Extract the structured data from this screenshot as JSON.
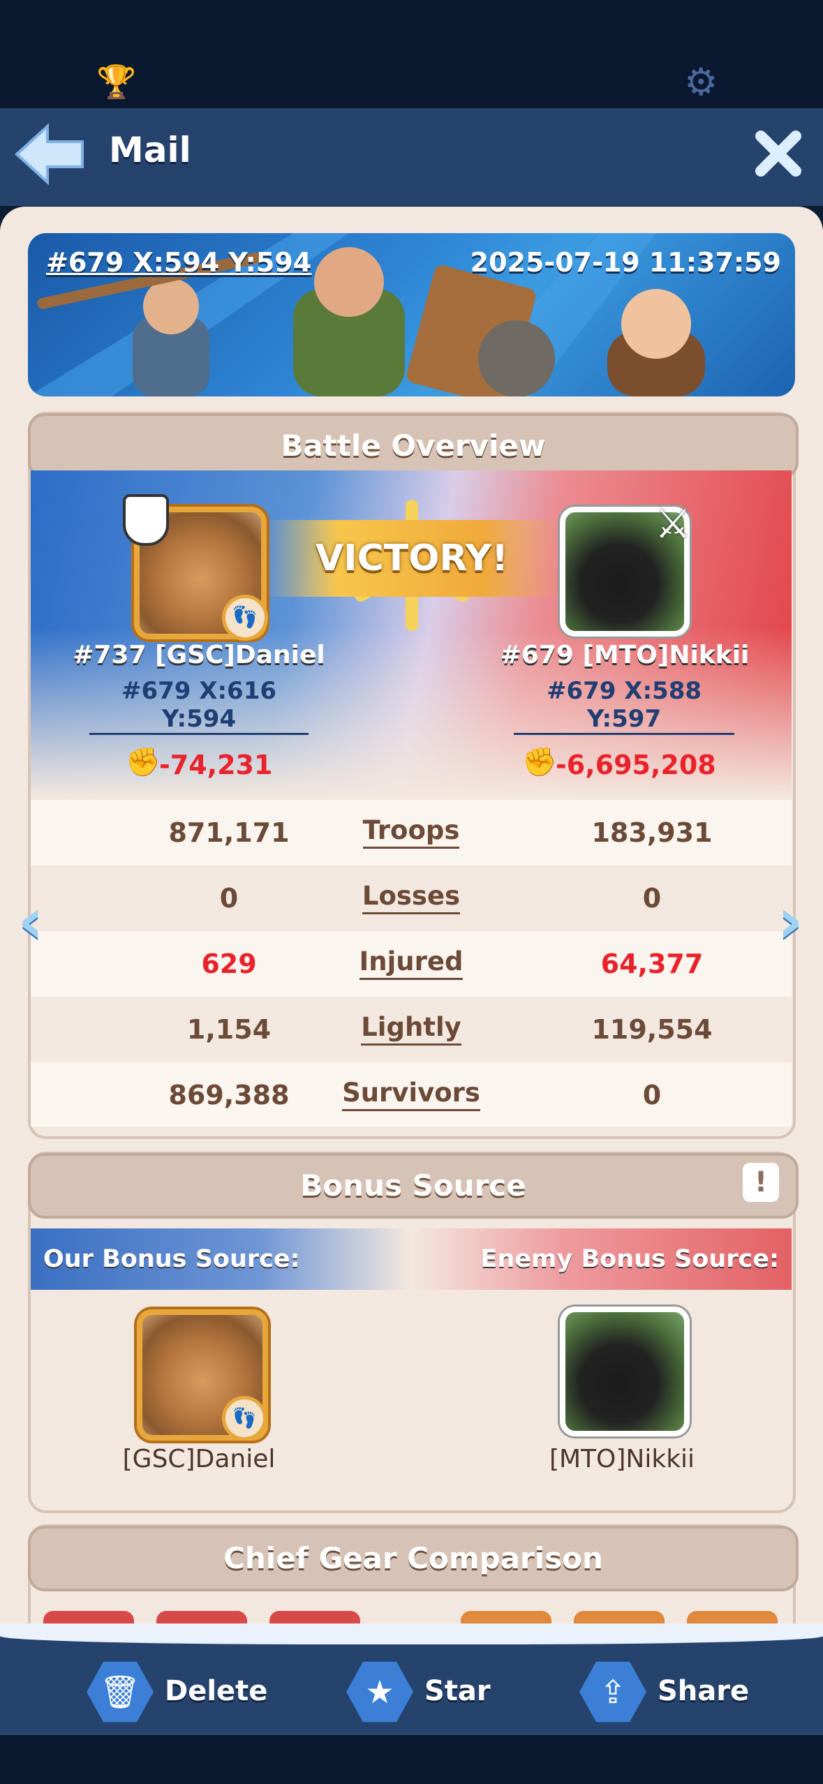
{
  "header": {
    "title": "Mail",
    "back_icon": "back-arrow-icon",
    "close_icon": "close-icon",
    "trophy_icon": "trophy-icon",
    "settings_icon": "gear-icon"
  },
  "banner": {
    "coords": "#679 X:594 Y:594",
    "timestamp": "2025-07-19 11:37:59"
  },
  "battle_overview": {
    "title": "Battle Overview",
    "result": "VICTORY!",
    "left_player": {
      "name": "#737 [GSC]Daniel",
      "coords": "#679 X:616 Y:594",
      "power_change": "-74,231"
    },
    "right_player": {
      "name": "#679 [MTO]Nikkii",
      "coords": "#679 X:588 Y:597",
      "power_change": "-6,695,208"
    },
    "stats": [
      {
        "label": "Troops",
        "left": "871,171",
        "right": "183,931"
      },
      {
        "label": "Losses",
        "left": "0",
        "right": "0"
      },
      {
        "label": "Injured",
        "left": "629",
        "right": "64,377"
      },
      {
        "label": "Lightly Injured",
        "left": "1,154",
        "right": "119,554"
      },
      {
        "label": "Survivors",
        "left": "869,388",
        "right": "0"
      }
    ]
  },
  "bonus_source": {
    "title": "Bonus Source",
    "our_label": "Our Bonus Source:",
    "enemy_label": "Enemy Bonus Source:",
    "our_name": "[GSC]Daniel",
    "enemy_name": "[MTO]Nikkii",
    "info_icon": "exclamation-icon"
  },
  "chief_gear": {
    "title": "Chief Gear Comparison"
  },
  "bottom": {
    "delete_label": "Delete",
    "star_label": "Star",
    "share_label": "Share"
  },
  "colors": {
    "accent_blue": "#26436d",
    "loss_red": "#e8232b",
    "panel": "#f3e8df"
  }
}
